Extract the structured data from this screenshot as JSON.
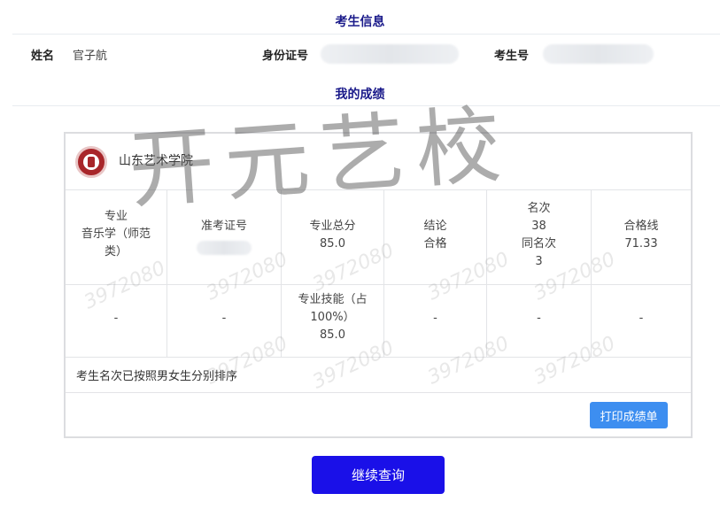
{
  "header": {
    "candidate_info_title": "考生信息"
  },
  "candidate": {
    "name_label": "姓名",
    "name_value": "官子航",
    "id_label": "身份证号",
    "exam_no_label": "考生号"
  },
  "scores": {
    "title": "我的成绩",
    "school_name": "山东艺术学院",
    "row1": {
      "col1": [
        "专业",
        "音乐学（师范",
        "类）"
      ],
      "col2": "准考证号",
      "col3": [
        "专业总分",
        "85.0"
      ],
      "col4": [
        "结论",
        "合格"
      ],
      "col5": [
        "名次",
        "38",
        "同名次",
        "3"
      ],
      "col6": [
        "合格线",
        "71.33"
      ]
    },
    "row2": {
      "col1": "-",
      "col2": "-",
      "col3": [
        "专业技能（占",
        "100%）",
        "85.0"
      ],
      "col4": "-",
      "col5": "-",
      "col6": "-"
    },
    "note": "考生名次已按照男女生分别排序",
    "print_button": "打印成绩单"
  },
  "continue_button": "继续查询",
  "watermark": {
    "big": "开元艺校",
    "number": "3972080"
  },
  "colors": {
    "title": "#1a1a8a",
    "print_button": "#3d8ef0",
    "continue_button": "#1a10e8"
  }
}
